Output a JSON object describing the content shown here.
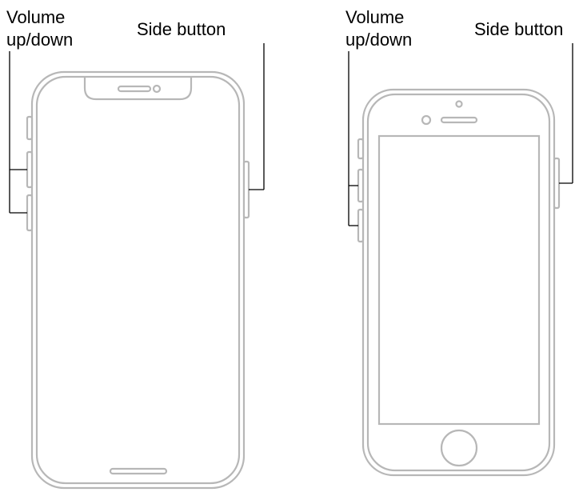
{
  "labels": {
    "phone1": {
      "volume": "Volume\nup/down",
      "side": "Side button"
    },
    "phone2": {
      "volume": "Volume\nup/down",
      "side": "Side button"
    }
  }
}
